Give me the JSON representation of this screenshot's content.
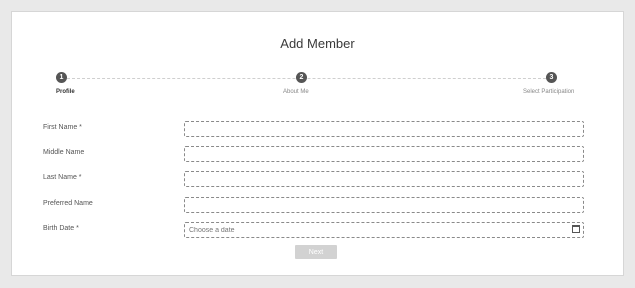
{
  "form": {
    "title": "Add Member",
    "steps": [
      {
        "number": "1",
        "label": "Profile"
      },
      {
        "number": "2",
        "label": "About Me"
      },
      {
        "number": "3",
        "label": "Select Participation"
      }
    ],
    "fields": [
      {
        "label": "First Name *",
        "value": "",
        "placeholder": ""
      },
      {
        "label": "Middle Name",
        "value": "",
        "placeholder": ""
      },
      {
        "label": "Last Name *",
        "value": "",
        "placeholder": ""
      },
      {
        "label": "Preferred Name",
        "value": "",
        "placeholder": ""
      },
      {
        "label": "Birth Date *",
        "value": "",
        "placeholder": "Choose a date"
      }
    ],
    "calendar_icon": "calendar-icon",
    "next_label": "Next"
  }
}
